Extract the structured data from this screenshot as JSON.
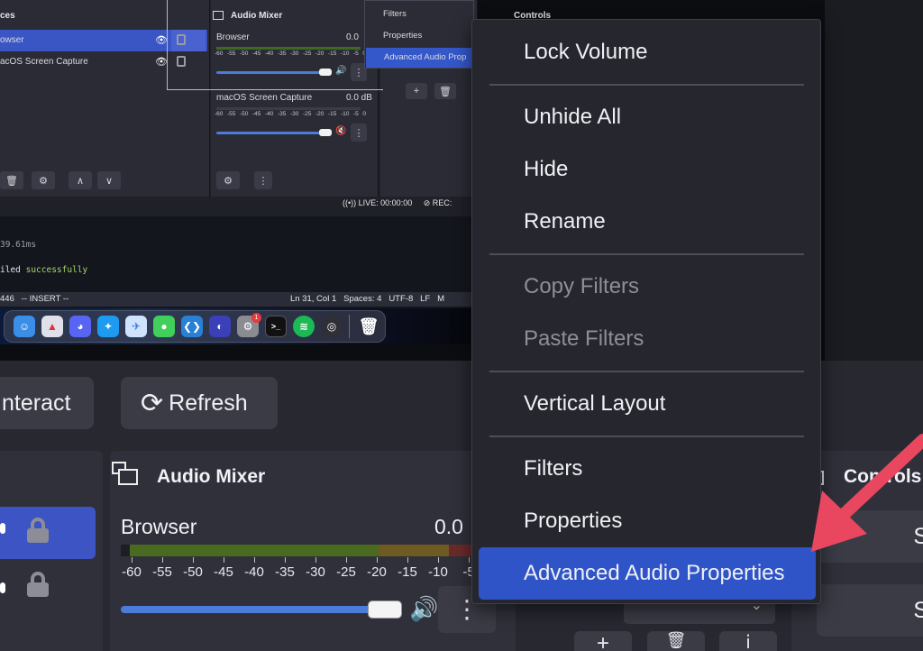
{
  "preview": {
    "sources": {
      "title": "ces",
      "items": [
        {
          "label": "owser",
          "selected": true
        },
        {
          "label": "acOS Screen Capture",
          "selected": false
        }
      ]
    },
    "audio_mixer": {
      "title": "Audio Mixer",
      "channels": [
        {
          "name": "Browser",
          "db": "0.0",
          "muted": false
        },
        {
          "name": "macOS Screen Capture",
          "db": "0.0 dB",
          "muted": true
        }
      ],
      "ticks": [
        "-60",
        "-55",
        "-50",
        "-45",
        "-40",
        "-35",
        "-30",
        "-25",
        "-20",
        "-15",
        "-10",
        "-5",
        "0"
      ]
    },
    "controls_title": "Controls",
    "mini_menu": [
      "Filters",
      "Properties",
      "Advanced Audio Prop"
    ],
    "status": {
      "live": "LIVE: 00:00:00",
      "rec": "REC:"
    },
    "terminal": {
      "line1": "39.61ms",
      "line2_prefix": "iled ",
      "line2_word": "successfully",
      "status_left": "446   -- INSERT --",
      "status_right": "Ln 31, Col 1   Spaces: 4   UTF-8   LF   M"
    },
    "dock_badge": "1"
  },
  "lower": {
    "interact_label": "nteract",
    "refresh_label": "Refresh",
    "audio_mixer_title": "Audio Mixer",
    "controls_title": "Controls",
    "channel": {
      "name": "Browser",
      "db": "0.0",
      "volume_fraction": 0.9
    },
    "ticks": [
      "-60",
      "-55",
      "-50",
      "-45",
      "-40",
      "-35",
      "-30",
      "-25",
      "-20",
      "-15",
      "-10",
      "-5"
    ],
    "side_btn_1": "S",
    "side_btn_2": "S"
  },
  "context_menu": {
    "items": [
      {
        "label": "Lock Volume",
        "enabled": true
      },
      {
        "label": "Unhide All",
        "enabled": true
      },
      {
        "label": "Hide",
        "enabled": true
      },
      {
        "label": "Rename",
        "enabled": true
      },
      {
        "label": "Copy Filters",
        "enabled": false
      },
      {
        "label": "Paste Filters",
        "enabled": false
      },
      {
        "label": "Vertical Layout",
        "enabled": true
      },
      {
        "label": "Filters",
        "enabled": true
      },
      {
        "label": "Properties",
        "enabled": true
      },
      {
        "label": "Advanced Audio Properties",
        "enabled": true,
        "highlighted": true
      }
    ]
  },
  "colors": {
    "highlight": "#2e54c8",
    "arrow": "#e8475f",
    "meter_green": "#4a6a1f",
    "meter_yellow": "#6e5a23",
    "meter_red": "#6a2a2a",
    "slider": "#4d7bd8"
  }
}
